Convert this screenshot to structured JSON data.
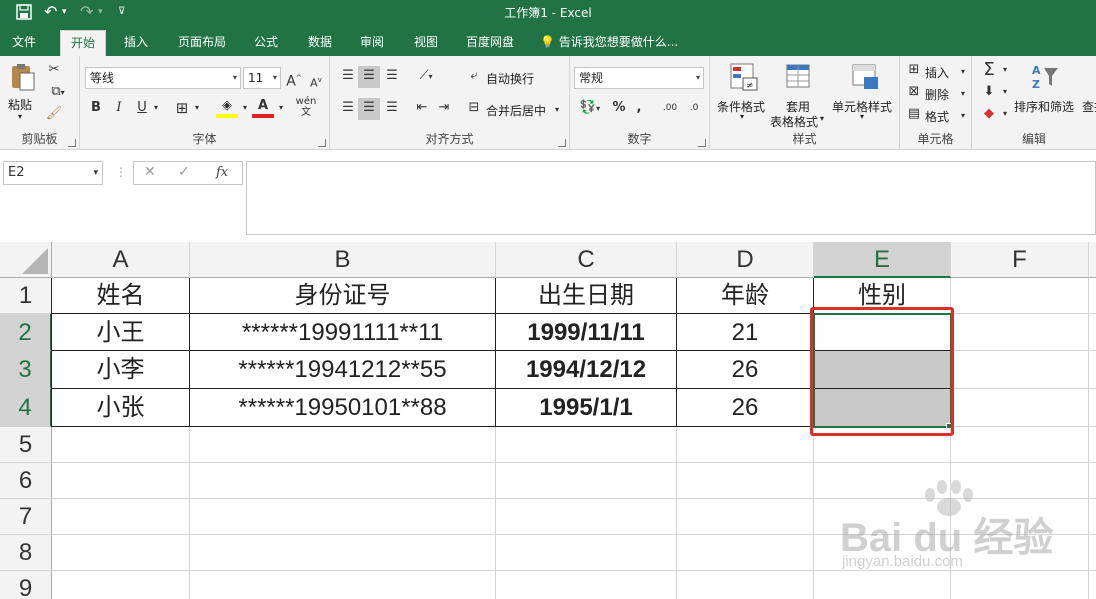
{
  "window": {
    "title": "工作簿1 - Excel"
  },
  "qat": {
    "save_icon": "save-icon",
    "undo_icon": "undo-icon",
    "redo_icon": "redo-icon",
    "customize_icon": "customize-icon"
  },
  "tabs": [
    {
      "label": "文件"
    },
    {
      "label": "开始"
    },
    {
      "label": "插入"
    },
    {
      "label": "页面布局"
    },
    {
      "label": "公式"
    },
    {
      "label": "数据"
    },
    {
      "label": "审阅"
    },
    {
      "label": "视图"
    },
    {
      "label": "百度网盘"
    }
  ],
  "tell_me": "告诉我您想要做什么...",
  "ribbon": {
    "clipboard": {
      "label": "剪贴板",
      "paste": "粘贴"
    },
    "font": {
      "label": "字体",
      "font_name": "等线",
      "font_size": "11",
      "bold": "B",
      "italic": "I",
      "underline": "U"
    },
    "alignment": {
      "label": "对齐方式",
      "wrap": "自动换行",
      "merge": "合并后居中"
    },
    "number": {
      "label": "数字",
      "format": "常规",
      "percent": "%",
      "comma": ",",
      "inc_dec": ".00",
      "dec_dec": ".0"
    },
    "styles": {
      "label": "样式",
      "conditional": "条件格式",
      "table_line1": "套用",
      "table_line2": "表格格式",
      "cell_styles": "单元格样式"
    },
    "cells": {
      "label": "单元格",
      "insert": "插入",
      "delete": "删除",
      "format": "格式"
    },
    "editing": {
      "label": "编辑",
      "sort": "排序和筛选",
      "find": "查找"
    }
  },
  "formula_bar": {
    "name_box": "E2",
    "cancel": "✕",
    "enter": "✓",
    "fx": "fx",
    "formula": ""
  },
  "sheet": {
    "columns": [
      "A",
      "B",
      "C",
      "D",
      "E",
      "F"
    ],
    "rows": [
      "1",
      "2",
      "3",
      "4",
      "5",
      "6",
      "7",
      "8",
      "9"
    ],
    "header": [
      "姓名",
      "身份证号",
      "出生日期",
      "年龄",
      "性别"
    ],
    "data": [
      [
        "小王",
        "******19991111**11",
        "1999/11/11",
        "21",
        ""
      ],
      [
        "小李",
        "******19941212**55",
        "1994/12/12",
        "26",
        ""
      ],
      [
        "小张",
        "******19950101**88",
        "1995/1/1",
        "26",
        ""
      ]
    ],
    "selection": "E2:E4",
    "colors": {
      "accent": "#217346",
      "highlight": "#d9302c",
      "selection_fill": "#c9c9c9"
    }
  },
  "watermark": {
    "brand": "Bai du 经验",
    "url": "jingyan.baidu.com"
  }
}
